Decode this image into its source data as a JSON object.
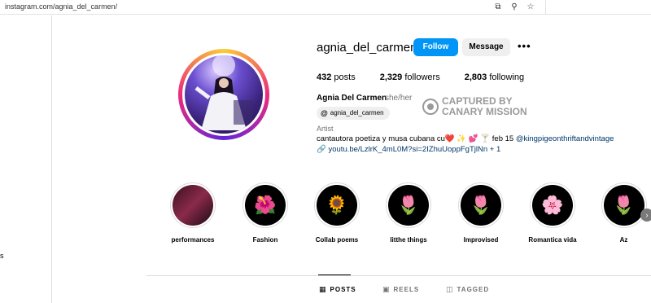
{
  "browser": {
    "url": "instagram.com/agnia_del_carmen/",
    "icons": [
      "install-icon",
      "zoom-icon",
      "bookmark-star-icon"
    ]
  },
  "sidebar": {
    "fragment": "s"
  },
  "profile": {
    "username": "agnia_del_carmen",
    "follow_label": "Follow",
    "message_label": "Message",
    "more_label": "•••",
    "stats": {
      "posts_count": "432",
      "posts_label": "posts",
      "followers_count": "2,329",
      "followers_label": "followers",
      "following_count": "2,803",
      "following_label": "following"
    },
    "full_name": "Agnia Del Carmen",
    "pronouns": "she/her",
    "threads_handle": "agnia_del_carmen",
    "category": "Artist",
    "bio_text": "cantautora poetiza y musa cubana cu❤️ ✨ 💕 🍸 feb 15 ",
    "bio_mention": "@kingpigeonthriftandvintage",
    "link_text": "youtu.be/LzlrK_4mL0M?si=2IZhuUoppFgTjlNn + 1"
  },
  "watermark": {
    "line1": "CAPTURED BY",
    "line2": "CANARY MISSION"
  },
  "highlights": [
    {
      "label": "performances",
      "icon": "photo"
    },
    {
      "label": "Fashion",
      "icon": "🌺"
    },
    {
      "label": "Collab poems",
      "icon": "🌻"
    },
    {
      "label": "litthe things",
      "icon": "🌷"
    },
    {
      "label": "Improvised",
      "icon": "🌷"
    },
    {
      "label": "Romantica vida",
      "icon": "🌸"
    },
    {
      "label": "Az",
      "icon": "🌷"
    }
  ],
  "tabs": [
    {
      "label": "POSTS",
      "icon": "grid-icon",
      "active": true
    },
    {
      "label": "REELS",
      "icon": "reels-icon",
      "active": false
    },
    {
      "label": "TAGGED",
      "icon": "tagged-icon",
      "active": false
    }
  ],
  "colors": {
    "accent": "#0095f6",
    "link": "#00376b",
    "muted": "#737373"
  }
}
